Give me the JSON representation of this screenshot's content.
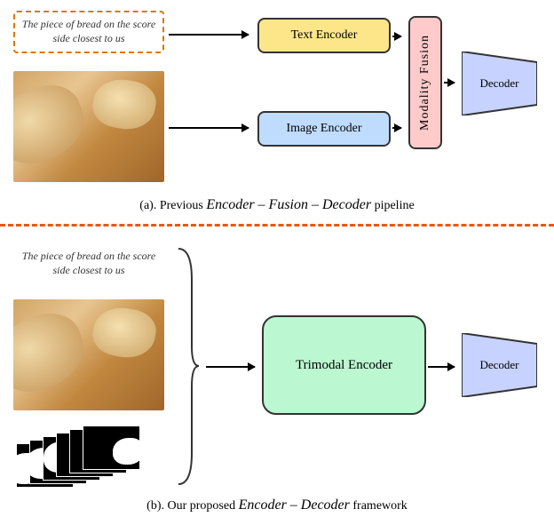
{
  "panel_a": {
    "text_query": "The piece of bread on the score side closest to us",
    "text_encoder_label": "Text Encoder",
    "image_encoder_label": "Image Encoder",
    "fusion_label": "Modality Fusion",
    "decoder_label": "Decoder",
    "caption_prefix": "(a). Previous ",
    "caption_fancy": "Encoder – Fusion – Decoder",
    "caption_suffix": " pipeline"
  },
  "panel_b": {
    "text_query": "The piece of bread on the score side closest to us",
    "trimodal_label": "Trimodal Encoder",
    "decoder_label": "Decoder",
    "caption_prefix": "(b). Our proposed ",
    "caption_fancy": "Encoder – Decoder",
    "caption_suffix": " framework"
  },
  "colors": {
    "text_enc": "#fde68a",
    "image_enc": "#bfdbfe",
    "fusion": "#fecaca",
    "trimodal": "#bbf7d0",
    "decoder": "#c7d2fe",
    "divider": "#ea580c"
  }
}
